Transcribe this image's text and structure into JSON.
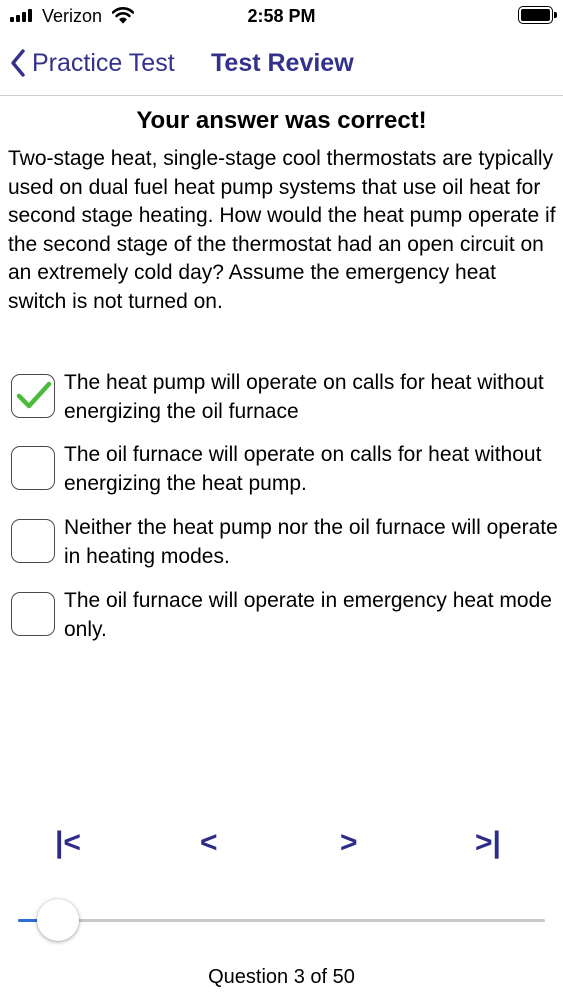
{
  "status_bar": {
    "carrier": "Verizon",
    "time": "2:58 PM",
    "signal_icon": "signal-bars-icon",
    "wifi_icon": "wifi-icon",
    "battery_icon": "battery-icon"
  },
  "nav": {
    "back_label": "Practice Test",
    "title": "Test Review",
    "accent_color": "#33318a"
  },
  "result": "Your answer was correct!",
  "question": "Two-stage heat, single-stage cool thermostats are typically used on dual fuel heat pump systems that use oil heat for second stage heating. How would the heat pump operate if the second stage of the thermostat had an open circuit on an extremely cold day? Assume the emergency heat switch is not turned on.",
  "answers": [
    {
      "text": "The heat pump will operate on calls for heat without energizing the oil furnace",
      "checked": true
    },
    {
      "text": "The oil furnace will operate on calls for heat without energizing the heat pump.",
      "checked": false
    },
    {
      "text": "Neither the heat pump nor the oil furnace will operate in heating modes.",
      "checked": false
    },
    {
      "text": "The oil furnace will operate in emergency heat mode only.",
      "checked": false
    }
  ],
  "check_color": "#4cbb3c",
  "navigation": {
    "first": "|<",
    "previous": "<",
    "next": ">",
    "last": ">|"
  },
  "slider": {
    "current": 3,
    "total": 50,
    "fill_color": "#2a6fd6"
  },
  "counter": "Question 3 of 50"
}
